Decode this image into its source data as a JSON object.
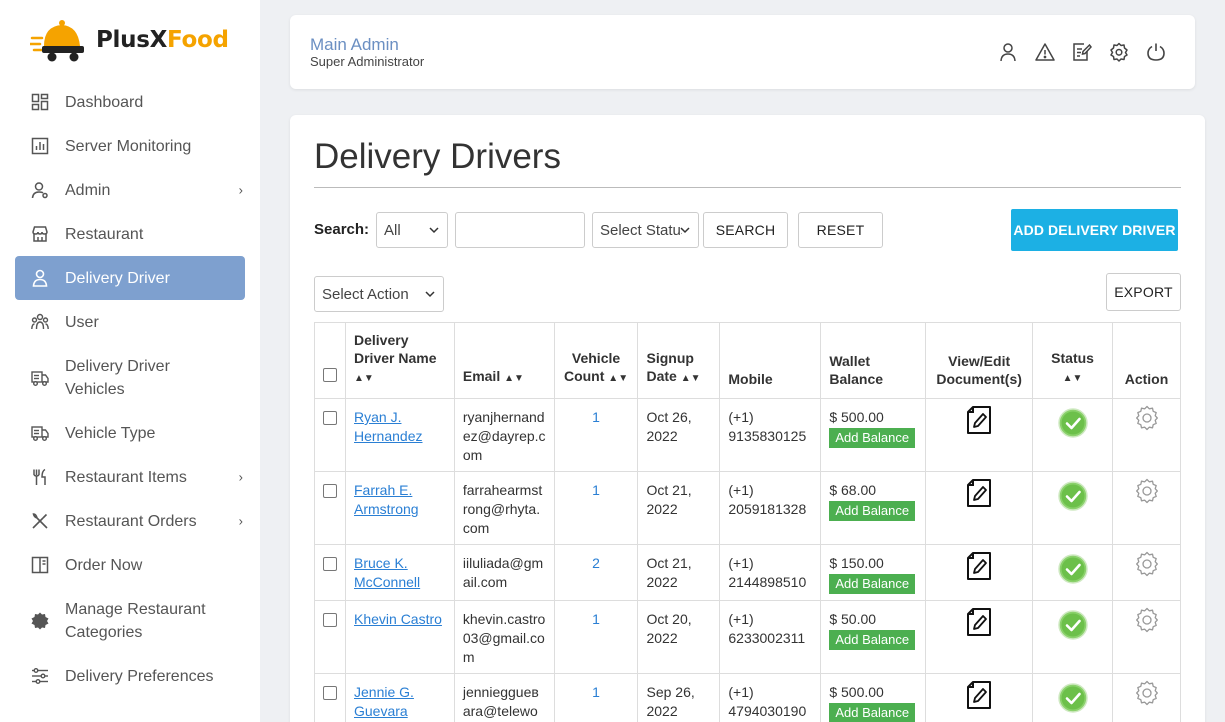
{
  "brand": {
    "part1": "PlusX",
    "part2": "Food"
  },
  "sidebar": {
    "items": [
      {
        "label": "Dashboard",
        "icon": "dashboard-icon",
        "chevron": false,
        "active": false
      },
      {
        "label": "Server Monitoring",
        "icon": "chart-icon",
        "chevron": false,
        "active": false
      },
      {
        "label": "Admin",
        "icon": "admin-user-icon",
        "chevron": true,
        "active": false
      },
      {
        "label": "Restaurant",
        "icon": "store-icon",
        "chevron": false,
        "active": false
      },
      {
        "label": "Delivery Driver",
        "icon": "driver-icon",
        "chevron": false,
        "active": true
      },
      {
        "label": "User",
        "icon": "users-icon",
        "chevron": false,
        "active": false
      },
      {
        "label": "Delivery Driver Vehicles",
        "icon": "truck-icon",
        "chevron": false,
        "active": false
      },
      {
        "label": "Vehicle Type",
        "icon": "truck-icon",
        "chevron": false,
        "active": false
      },
      {
        "label": "Restaurant Items",
        "icon": "fork-knife-icon",
        "chevron": true,
        "active": false
      },
      {
        "label": "Restaurant Orders",
        "icon": "utensils-cross-icon",
        "chevron": true,
        "active": false
      },
      {
        "label": "Order Now",
        "icon": "menu-book-icon",
        "chevron": false,
        "active": false
      },
      {
        "label": "Manage Restaurant Categories",
        "icon": "badge-icon",
        "chevron": false,
        "active": false
      },
      {
        "label": "Delivery Preferences",
        "icon": "sliders-icon",
        "chevron": false,
        "active": false
      }
    ]
  },
  "header": {
    "name": "Main Admin",
    "role": "Super Administrator",
    "icons": [
      "profile-icon",
      "warning-icon",
      "edit-note-icon",
      "settings-icon",
      "power-icon"
    ]
  },
  "main": {
    "title": "Delivery Drivers",
    "search_label": "Search:",
    "search_field_value": "All",
    "search_input_value": "",
    "status_select_value": "Select Status",
    "search_button": "SEARCH",
    "reset_button": "RESET",
    "add_button": "ADD DELIVERY DRIVER",
    "action_select_value": "Select Action",
    "export_button": "EXPORT"
  },
  "table": {
    "headers": {
      "name": "Delivery Driver Name",
      "email": "Email",
      "vehicle_count": "Vehicle Count",
      "signup_date": "Signup Date",
      "mobile": "Mobile",
      "wallet": "Wallet Balance",
      "docs": "View/Edit Document(s)",
      "status": "Status",
      "action": "Action"
    },
    "add_balance_label": "Add Balance",
    "rows": [
      {
        "name": "Ryan J. Hernandez",
        "email": "ryanjhernandez@dayrep.com",
        "vehicles": "1",
        "date": "Oct 26, 2022",
        "mobile": "(+1) 9135830125",
        "wallet": "$ 500.00"
      },
      {
        "name": "Farrah E. Armstrong",
        "email": "farrahearmstrong@rhyta.com",
        "vehicles": "1",
        "date": "Oct 21, 2022",
        "mobile": "(+1) 2059181328",
        "wallet": "$ 68.00"
      },
      {
        "name": "Bruce K. McConnell",
        "email": "iiluliada@gmail.com",
        "vehicles": "2",
        "date": "Oct 21, 2022",
        "mobile": "(+1) 2144898510",
        "wallet": "$ 150.00"
      },
      {
        "name": "Khevin Castro",
        "email": "khevin.castro03@gmail.com",
        "vehicles": "1",
        "date": "Oct 20, 2022",
        "mobile": "(+1) 6233002311",
        "wallet": "$ 50.00"
      },
      {
        "name": "Jennie G. Guevara",
        "email": "jennieggueвara@telewo",
        "vehicles": "1",
        "date": "Sep 26, 2022",
        "mobile": "(+1) 4794030190",
        "wallet": "$ 500.00"
      }
    ]
  },
  "colors": {
    "accent": "#7ea0cf",
    "primary_button": "#1cb0e4",
    "success": "#4caf50",
    "brand_orange": "#f5a300"
  }
}
